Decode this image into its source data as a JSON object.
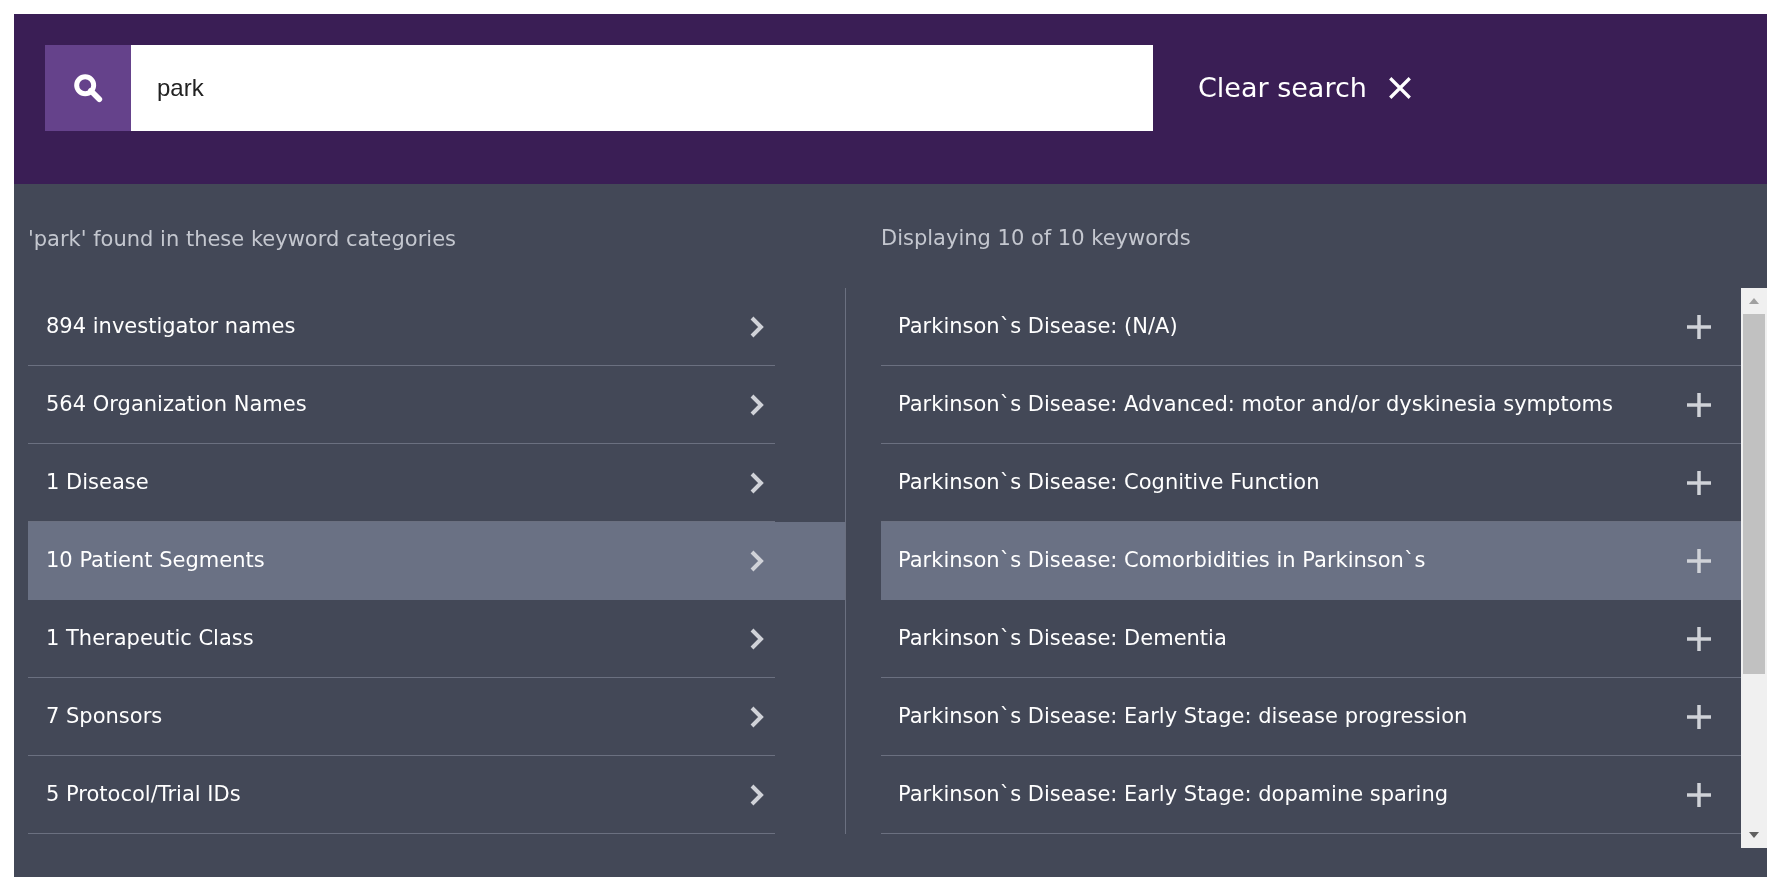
{
  "search": {
    "value": "park"
  },
  "clear_search": {
    "label": "Clear search"
  },
  "categories": {
    "heading": "'park' found in these keyword categories",
    "items": [
      {
        "label": "894 investigator names",
        "selected": false
      },
      {
        "label": "564 Organization Names",
        "selected": false
      },
      {
        "label": "1 Disease",
        "selected": false
      },
      {
        "label": "10 Patient Segments",
        "selected": true
      },
      {
        "label": "1 Therapeutic Class",
        "selected": false
      },
      {
        "label": "7 Sponsors",
        "selected": false
      },
      {
        "label": "5 Protocol/Trial IDs",
        "selected": false
      }
    ]
  },
  "keywords": {
    "heading": "Displaying 10 of 10 keywords",
    "items": [
      {
        "label": "Parkinson`s Disease: (N/A)",
        "selected": false
      },
      {
        "label": "Parkinson`s Disease: Advanced: motor and/or dyskinesia symptoms",
        "selected": false
      },
      {
        "label": "Parkinson`s Disease: Cognitive Function",
        "selected": false
      },
      {
        "label": "Parkinson`s Disease: Comorbidities in Parkinson`s",
        "selected": true
      },
      {
        "label": "Parkinson`s Disease: Dementia",
        "selected": false
      },
      {
        "label": "Parkinson`s Disease: Early Stage: disease progression",
        "selected": false
      },
      {
        "label": "Parkinson`s Disease: Early Stage: dopamine sparing",
        "selected": false
      }
    ]
  }
}
